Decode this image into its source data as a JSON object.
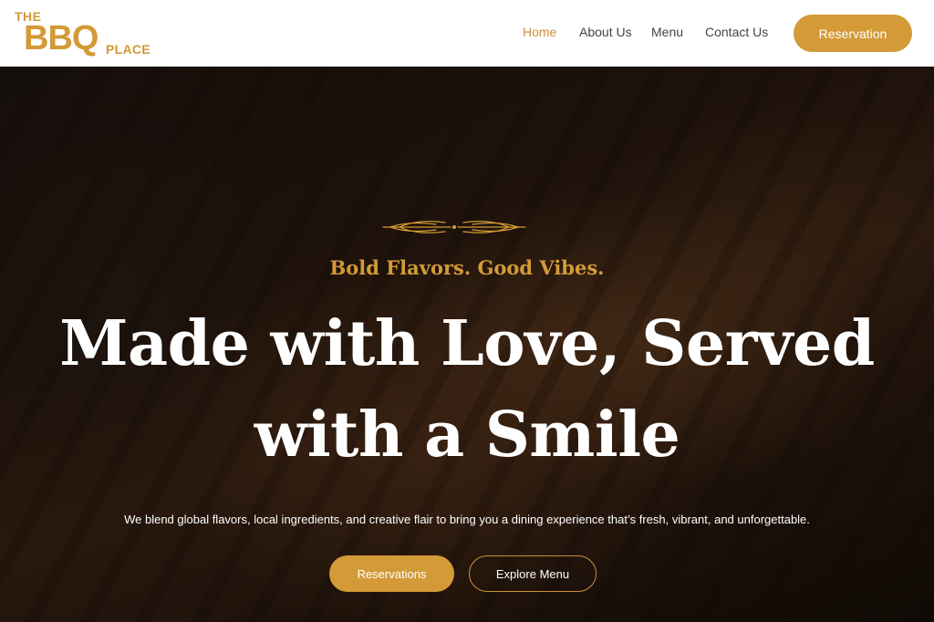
{
  "brand": {
    "line1": "THE",
    "line2": "BBQ",
    "line3": "PLACE",
    "color": "#d39a37"
  },
  "nav": {
    "items": [
      {
        "label": "Home",
        "active": true
      },
      {
        "label": "About Us",
        "active": false
      },
      {
        "label": "Menu",
        "active": false
      },
      {
        "label": "Contact Us",
        "active": false
      }
    ],
    "cta_label": "Reservation"
  },
  "hero": {
    "ornament_icon": "wheat-divider-icon",
    "tagline": "Bold Flavors. Good Vibes.",
    "headline_line1": "Made with Love, Served",
    "headline_line2": "with a Smile",
    "subtext": "We blend global flavors, local ingredients, and creative flair to bring you a dining experience that’s fresh, vibrant, and unforgettable.",
    "primary_button": "Reservations",
    "secondary_button": "Explore Menu"
  },
  "colors": {
    "accent": "#d39a37",
    "nav_active": "#c9913b",
    "nav_text": "#444444",
    "hero_text": "#ffffff"
  }
}
